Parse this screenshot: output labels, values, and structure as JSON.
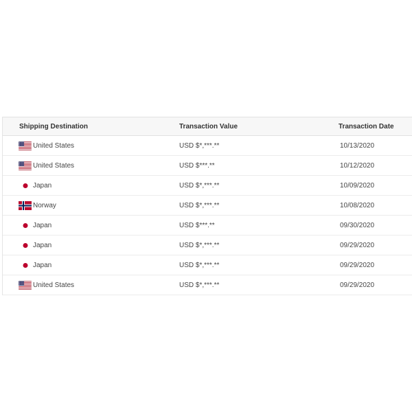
{
  "table": {
    "headers": {
      "destination": "Shipping Destination",
      "value": "Transaction Value",
      "date": "Transaction Date"
    },
    "rows": [
      {
        "flag": "us-flag-icon",
        "country": "United States",
        "value": "USD $*,***.**",
        "date": "10/13/2020"
      },
      {
        "flag": "us-flag-icon",
        "country": "United States",
        "value": "USD $***.**",
        "date": "10/12/2020"
      },
      {
        "flag": "jp-flag-icon",
        "country": "Japan",
        "value": "USD $*,***.**",
        "date": "10/09/2020"
      },
      {
        "flag": "no-flag-icon",
        "country": "Norway",
        "value": "USD $*,***.**",
        "date": "10/08/2020"
      },
      {
        "flag": "jp-flag-icon",
        "country": "Japan",
        "value": "USD $***.**",
        "date": "09/30/2020"
      },
      {
        "flag": "jp-flag-icon",
        "country": "Japan",
        "value": "USD $*,***.**",
        "date": "09/29/2020"
      },
      {
        "flag": "jp-flag-icon",
        "country": "Japan",
        "value": "USD $*,***.**",
        "date": "09/29/2020"
      },
      {
        "flag": "us-flag-icon",
        "country": "United States",
        "value": "USD $*,***.**",
        "date": "09/29/2020"
      }
    ]
  },
  "colors": {
    "japan_red": "#bc002d",
    "norway_red": "#ba0c2f",
    "norway_blue": "#00205b",
    "us_red": "#b22234",
    "us_blue": "#3c3b6e"
  }
}
